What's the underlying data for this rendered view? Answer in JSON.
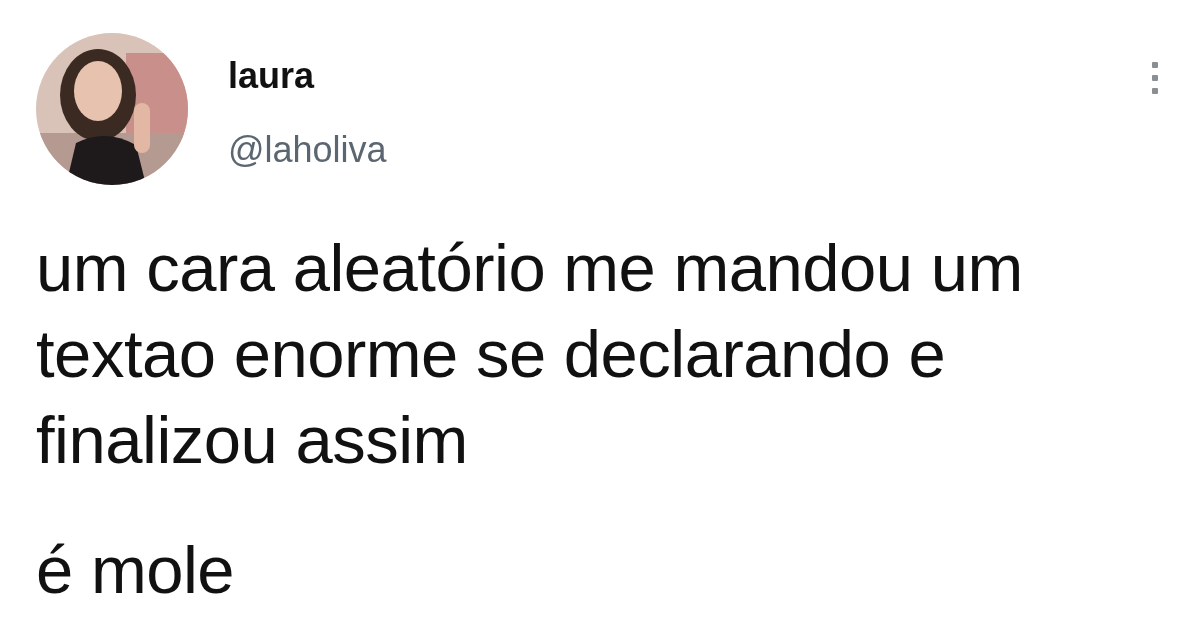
{
  "tweet": {
    "author": {
      "name": "laura",
      "handle": "@laholiva"
    },
    "paragraphs": [
      "um cara aleatório me mandou um textao enorme se declarando e finalizou assim",
      "é mole"
    ]
  }
}
